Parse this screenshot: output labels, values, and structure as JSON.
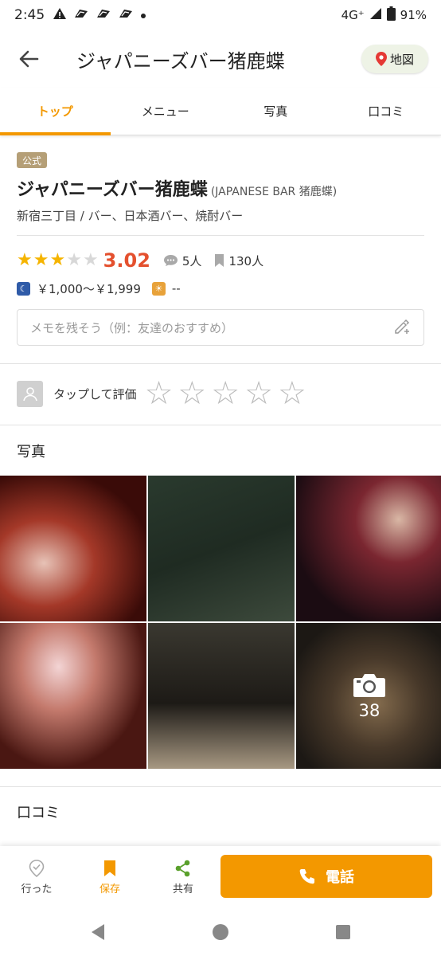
{
  "status": {
    "time": "2:45",
    "network": "4G⁺",
    "battery": "91%"
  },
  "appbar": {
    "title": "ジャパニーズバー猪鹿蝶",
    "map_label": "地図"
  },
  "tabs": [
    {
      "label": "トップ",
      "active": true
    },
    {
      "label": "メニュー",
      "active": false
    },
    {
      "label": "写真",
      "active": false
    },
    {
      "label": "口コミ",
      "active": false
    }
  ],
  "shop": {
    "badge": "公式",
    "name": "ジャパニーズバー猪鹿蝶",
    "name_en": "(JAPANESE BAR 猪鹿蝶)",
    "genre": "新宿三丁目 / バー、日本酒バー、焼酎バー",
    "rating_stars": 3,
    "score": "3.02",
    "reviews": "5人",
    "saves": "130人",
    "dinner_price": "￥1,000～￥1,999",
    "lunch_price": "--",
    "accent": "#f39800",
    "score_color": "#e4502e"
  },
  "memo": {
    "placeholder": "メモを残そう（例：友達のおすすめ）"
  },
  "rate": {
    "label": "タップして評価"
  },
  "photos": {
    "title": "写真",
    "more_count": "38"
  },
  "reviews_section": {
    "title": "口コミ"
  },
  "bottom": {
    "visited": "行った",
    "save": "保存",
    "share": "共有",
    "call": "電話"
  }
}
